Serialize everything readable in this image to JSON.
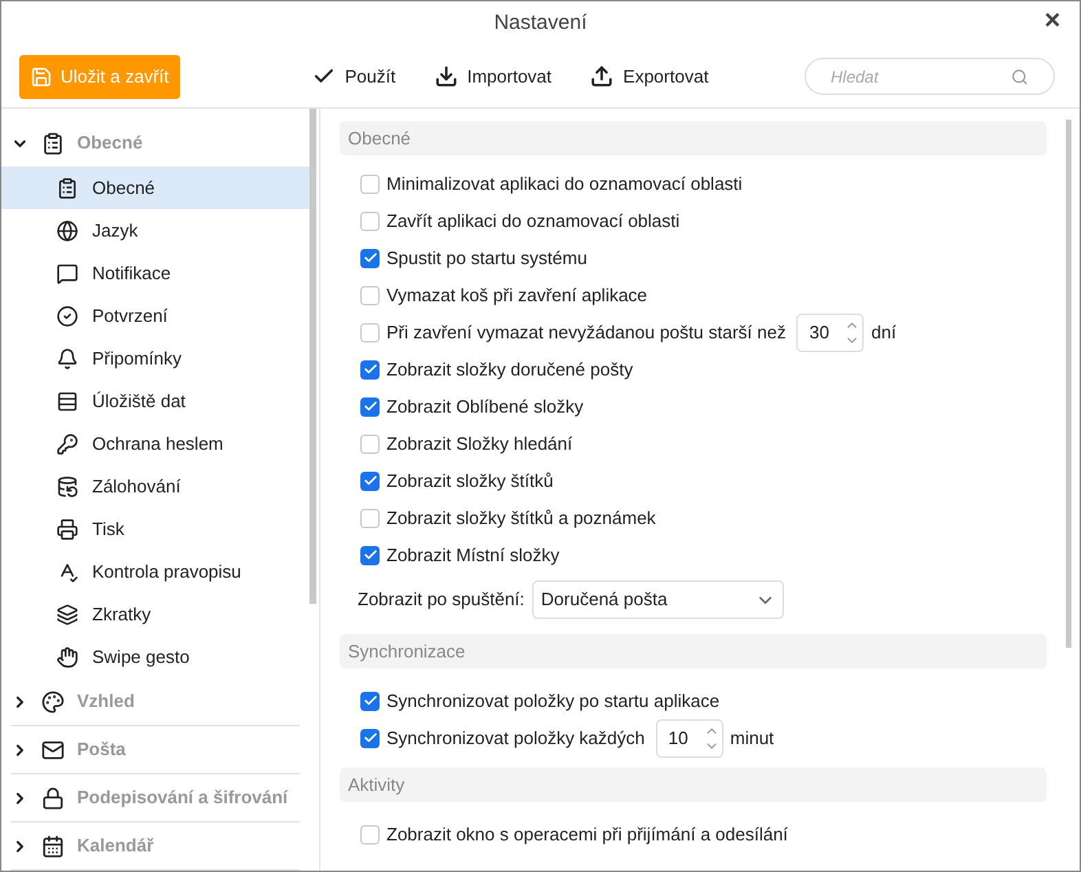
{
  "window": {
    "title": "Nastavení",
    "close": "×"
  },
  "toolbar": {
    "save_button": "Uložit a zavřít",
    "actions": [
      "Použít",
      "Importovat",
      "Exportovat"
    ],
    "search": {
      "placeholder": "Hledat"
    }
  },
  "sidebar": {
    "groups": [
      {
        "label": "Obecné",
        "expanded": true,
        "items": [
          {
            "label": "Obecné",
            "selected": true
          },
          {
            "label": "Jazyk",
            "selected": false
          },
          {
            "label": "Notifikace",
            "selected": false
          },
          {
            "label": "Potvrzení",
            "selected": false
          },
          {
            "label": "Připomínky",
            "selected": false
          },
          {
            "label": "Úložiště dat",
            "selected": false
          },
          {
            "label": "Ochrana heslem",
            "selected": false
          },
          {
            "label": "Zálohování",
            "selected": false
          },
          {
            "label": "Tisk",
            "selected": false
          },
          {
            "label": "Kontrola pravopisu",
            "selected": false
          },
          {
            "label": "Zkratky",
            "selected": false
          },
          {
            "label": "Swipe gesto",
            "selected": false
          }
        ]
      },
      {
        "label": "Vzhled",
        "expanded": false
      },
      {
        "label": "Pošta",
        "expanded": false
      },
      {
        "label": "Podepisování a šifrování",
        "expanded": false
      },
      {
        "label": "Kalendář",
        "expanded": false
      }
    ]
  },
  "sections": [
    {
      "title": "Obecné",
      "items": [
        {
          "kind": "checkbox",
          "label": "Minimalizovat aplikaci do oznamovací oblasti",
          "checked": false
        },
        {
          "kind": "checkbox",
          "label": "Zavřít aplikaci do oznamovací oblasti",
          "checked": false
        },
        {
          "kind": "checkbox",
          "label": "Spustit po startu systému",
          "checked": true
        },
        {
          "kind": "checkbox",
          "label": "Vymazat koš při zavření aplikace",
          "checked": false
        },
        {
          "kind": "number",
          "label": "Při zavření vymazat nevyžádanou poštu starší než",
          "checked": false,
          "value": "30",
          "unit": "dní"
        },
        {
          "kind": "checkbox",
          "label": "Zobrazit složky doručené pošty",
          "checked": true
        },
        {
          "kind": "checkbox",
          "label": "Zobrazit Oblíbené složky",
          "checked": true
        },
        {
          "kind": "checkbox",
          "label": "Zobrazit Složky hledání",
          "checked": false
        },
        {
          "kind": "checkbox",
          "label": "Zobrazit složky štítků",
          "checked": true
        },
        {
          "kind": "checkbox",
          "label": "Zobrazit složky štítků a poznámek",
          "checked": false
        },
        {
          "kind": "checkbox",
          "label": "Zobrazit Místní složky",
          "checked": true
        },
        {
          "kind": "select",
          "label": "Zobrazit po spuštění:",
          "value": "Doručená pošta"
        }
      ]
    },
    {
      "title": "Synchronizace",
      "items": [
        {
          "kind": "checkbox",
          "label": "Synchronizovat položky po startu aplikace",
          "checked": true
        },
        {
          "kind": "number",
          "label": "Synchronizovat položky každých",
          "checked": true,
          "value": "10",
          "unit": "minut"
        }
      ]
    },
    {
      "title": "Aktivity",
      "items": [
        {
          "kind": "checkbox",
          "label": "Zobrazit okno s operacemi při přijímání a odesílání",
          "checked": false
        }
      ]
    }
  ]
}
